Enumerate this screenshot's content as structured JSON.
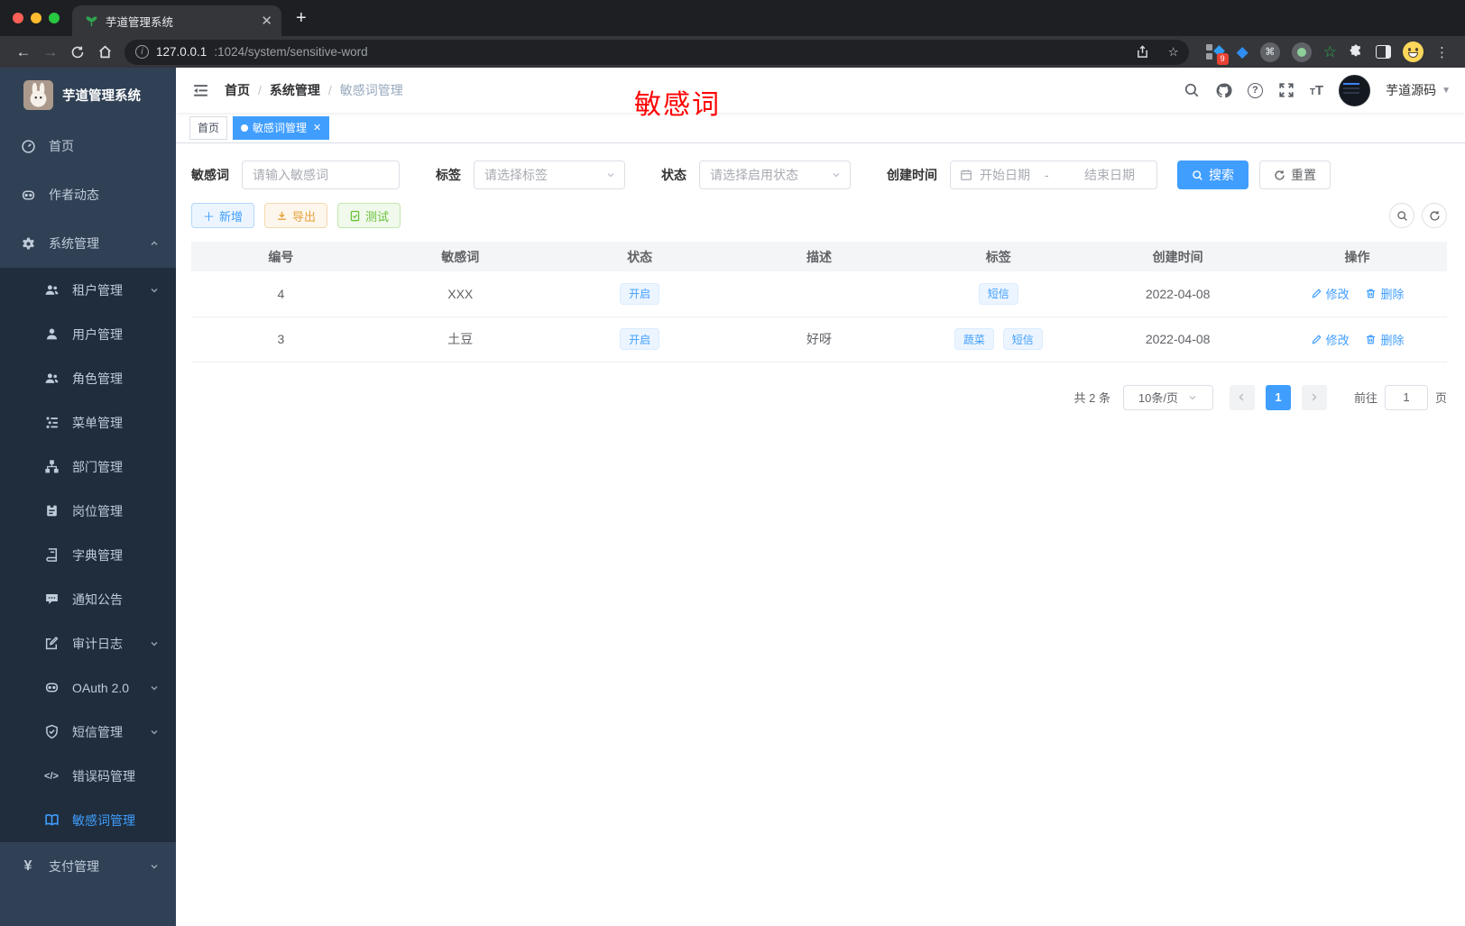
{
  "browser": {
    "tab_title": "芋道管理系统",
    "url_host": "127.0.0.1",
    "url_rest": ":1024/system/sensitive-word",
    "extension_badge": "9"
  },
  "sidebar": {
    "logo_title": "芋道管理系统",
    "items": [
      {
        "label": "首页"
      },
      {
        "label": "作者动态"
      },
      {
        "label": "系统管理"
      },
      {
        "label": "租户管理"
      },
      {
        "label": "用户管理"
      },
      {
        "label": "角色管理"
      },
      {
        "label": "菜单管理"
      },
      {
        "label": "部门管理"
      },
      {
        "label": "岗位管理"
      },
      {
        "label": "字典管理"
      },
      {
        "label": "通知公告"
      },
      {
        "label": "审计日志"
      },
      {
        "label": "OAuth 2.0"
      },
      {
        "label": "短信管理"
      },
      {
        "label": "错误码管理"
      },
      {
        "label": "敏感词管理"
      },
      {
        "label": "支付管理"
      }
    ]
  },
  "navbar": {
    "breadcrumb": {
      "home": "首页",
      "system": "系统管理",
      "current": "敏感词管理"
    },
    "user_name": "芋道源码"
  },
  "annotation": {
    "text": "敏感词",
    "color": "#ff0000"
  },
  "tags_view": {
    "home": "首页",
    "current": "敏感词管理"
  },
  "filters": {
    "keyword": {
      "label": "敏感词",
      "placeholder": "请输入敏感词"
    },
    "tag": {
      "label": "标签",
      "placeholder": "请选择标签"
    },
    "status": {
      "label": "状态",
      "placeholder": "请选择启用状态"
    },
    "date": {
      "label": "创建时间",
      "start_placeholder": "开始日期",
      "separator": "-",
      "end_placeholder": "结束日期"
    },
    "search_label": "搜索",
    "reset_label": "重置"
  },
  "toolbar": {
    "add_label": "新增",
    "export_label": "导出",
    "test_label": "测试"
  },
  "table": {
    "columns": [
      "编号",
      "敏感词",
      "状态",
      "描述",
      "标签",
      "创建时间",
      "操作"
    ],
    "rows": [
      {
        "id": "4",
        "word": "XXX",
        "status": "开启",
        "desc": "",
        "tags": [
          "短信"
        ],
        "created": "2022-04-08"
      },
      {
        "id": "3",
        "word": "土豆",
        "status": "开启",
        "desc": "好呀",
        "tags": [
          "蔬菜",
          "短信"
        ],
        "created": "2022-04-08"
      }
    ],
    "edit_label": "修改",
    "delete_label": "删除"
  },
  "pagination": {
    "total": "共 2 条",
    "page_size": "10条/页",
    "current_page": "1",
    "goto_label": "前往",
    "goto_value": "1",
    "unit_label": "页"
  },
  "colors": {
    "primary": "#409eff",
    "annotation_red": "#ff0000",
    "warning": "#e6a23c",
    "success": "#67c23a",
    "sidebar_bg": "#304156",
    "submenu_bg": "#1f2d3d"
  }
}
